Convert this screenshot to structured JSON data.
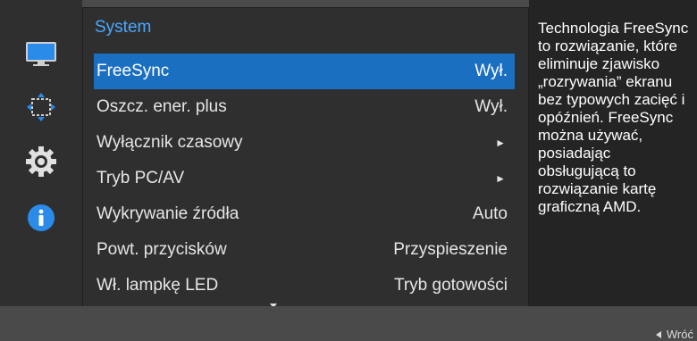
{
  "menu": {
    "header": "System",
    "rows": [
      {
        "label": "FreeSync",
        "value": "Wył."
      },
      {
        "label": "Oszcz. ener. plus",
        "value": "Wył."
      },
      {
        "label": "Wyłącznik czasowy",
        "value": "►"
      },
      {
        "label": "Tryb PC/AV",
        "value": "►"
      },
      {
        "label": "Wykrywanie źródła",
        "value": "Auto"
      },
      {
        "label": "Powt. przycisków",
        "value": "Przyspieszenie"
      },
      {
        "label": "Wł. lampkę LED",
        "value": "Tryb gotowości"
      }
    ]
  },
  "sidebar": {
    "icons": [
      "monitor-icon",
      "screen-adjust-icon",
      "gear-icon",
      "info-icon"
    ]
  },
  "help": {
    "text": "Technologia FreeSync to rozwiązanie, które eliminuje zjawisko „rozrywania” ekranu bez typowych zacięć i opóźnień. FreeSync można używać, posiadając obsługującą to rozwiązanie kartę graficzną AMD."
  },
  "footer": {
    "back_label": "Wróć"
  },
  "colors": {
    "accent": "#1b6fc0",
    "header": "#4aa8ff",
    "icon_blue": "#2a8be8"
  }
}
